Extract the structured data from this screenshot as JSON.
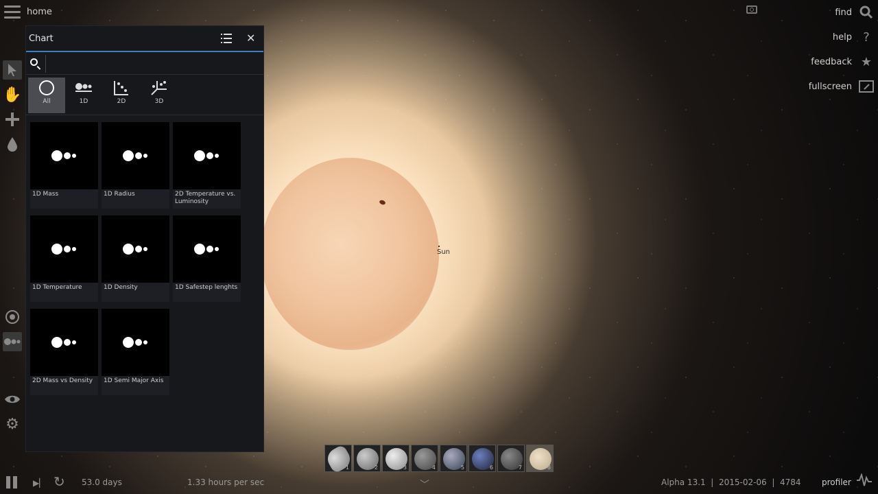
{
  "top": {
    "home": "home"
  },
  "right_menu": [
    {
      "label": "find",
      "icon": "search-icon"
    },
    {
      "label": "help",
      "icon": "question-icon"
    },
    {
      "label": "feedback",
      "icon": "star-icon"
    },
    {
      "label": "fullscreen",
      "icon": "fullscreen-icon"
    }
  ],
  "panel": {
    "title": "Chart",
    "search": {
      "value": "",
      "placeholder": ""
    },
    "filters": [
      {
        "label": "All",
        "active": true
      },
      {
        "label": "1D",
        "active": false
      },
      {
        "label": "2D",
        "active": false
      },
      {
        "label": "3D",
        "active": false
      }
    ],
    "cards": [
      {
        "label": "1D Mass"
      },
      {
        "label": "1D Radius"
      },
      {
        "label": "2D Temperature vs. Luminosity"
      },
      {
        "label": "1D Temperature"
      },
      {
        "label": "1D Density"
      },
      {
        "label": "1D Safestep lenghts"
      },
      {
        "label": "2D Mass vs Density"
      },
      {
        "label": "1D Semi Major Axis"
      }
    ]
  },
  "scene": {
    "object_label": "Sun"
  },
  "planets": [
    "1",
    "2",
    "3",
    "4",
    "5",
    "6",
    "7",
    "8"
  ],
  "bottom": {
    "elapsed": "53.0 days",
    "speed": "1.33 hours per sec",
    "status": "Alpha 13.1  |  2015-02-06  |  4784",
    "profiler": "profiler"
  },
  "colors": {
    "accent": "#3e7fc2",
    "panel_bg": "#17181c"
  }
}
